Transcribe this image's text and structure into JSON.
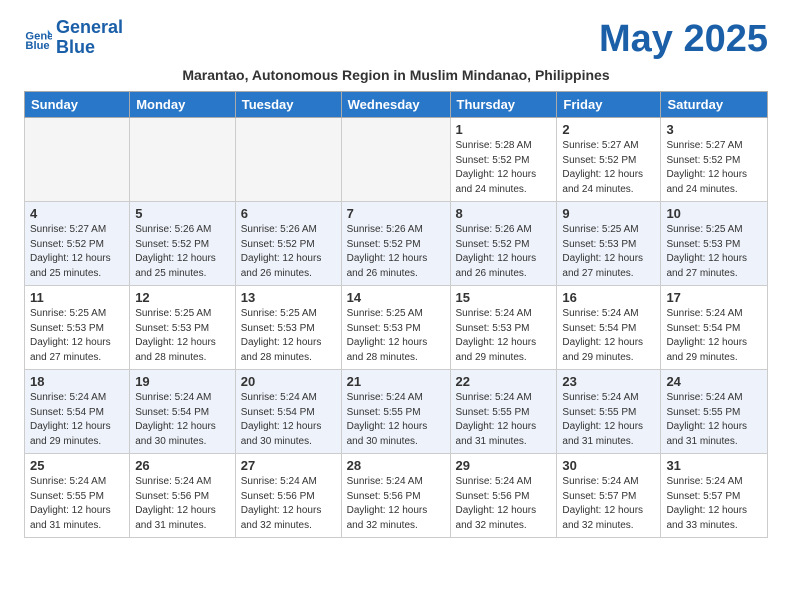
{
  "header": {
    "logo_line1": "General",
    "logo_line2": "Blue",
    "month_title": "May 2025",
    "subtitle": "Marantao, Autonomous Region in Muslim Mindanao, Philippines"
  },
  "days_of_week": [
    "Sunday",
    "Monday",
    "Tuesday",
    "Wednesday",
    "Thursday",
    "Friday",
    "Saturday"
  ],
  "weeks": [
    [
      {
        "day": "",
        "info": ""
      },
      {
        "day": "",
        "info": ""
      },
      {
        "day": "",
        "info": ""
      },
      {
        "day": "",
        "info": ""
      },
      {
        "day": "1",
        "info": "Sunrise: 5:28 AM\nSunset: 5:52 PM\nDaylight: 12 hours\nand 24 minutes."
      },
      {
        "day": "2",
        "info": "Sunrise: 5:27 AM\nSunset: 5:52 PM\nDaylight: 12 hours\nand 24 minutes."
      },
      {
        "day": "3",
        "info": "Sunrise: 5:27 AM\nSunset: 5:52 PM\nDaylight: 12 hours\nand 24 minutes."
      }
    ],
    [
      {
        "day": "4",
        "info": "Sunrise: 5:27 AM\nSunset: 5:52 PM\nDaylight: 12 hours\nand 25 minutes."
      },
      {
        "day": "5",
        "info": "Sunrise: 5:26 AM\nSunset: 5:52 PM\nDaylight: 12 hours\nand 25 minutes."
      },
      {
        "day": "6",
        "info": "Sunrise: 5:26 AM\nSunset: 5:52 PM\nDaylight: 12 hours\nand 26 minutes."
      },
      {
        "day": "7",
        "info": "Sunrise: 5:26 AM\nSunset: 5:52 PM\nDaylight: 12 hours\nand 26 minutes."
      },
      {
        "day": "8",
        "info": "Sunrise: 5:26 AM\nSunset: 5:52 PM\nDaylight: 12 hours\nand 26 minutes."
      },
      {
        "day": "9",
        "info": "Sunrise: 5:25 AM\nSunset: 5:53 PM\nDaylight: 12 hours\nand 27 minutes."
      },
      {
        "day": "10",
        "info": "Sunrise: 5:25 AM\nSunset: 5:53 PM\nDaylight: 12 hours\nand 27 minutes."
      }
    ],
    [
      {
        "day": "11",
        "info": "Sunrise: 5:25 AM\nSunset: 5:53 PM\nDaylight: 12 hours\nand 27 minutes."
      },
      {
        "day": "12",
        "info": "Sunrise: 5:25 AM\nSunset: 5:53 PM\nDaylight: 12 hours\nand 28 minutes."
      },
      {
        "day": "13",
        "info": "Sunrise: 5:25 AM\nSunset: 5:53 PM\nDaylight: 12 hours\nand 28 minutes."
      },
      {
        "day": "14",
        "info": "Sunrise: 5:25 AM\nSunset: 5:53 PM\nDaylight: 12 hours\nand 28 minutes."
      },
      {
        "day": "15",
        "info": "Sunrise: 5:24 AM\nSunset: 5:53 PM\nDaylight: 12 hours\nand 29 minutes."
      },
      {
        "day": "16",
        "info": "Sunrise: 5:24 AM\nSunset: 5:54 PM\nDaylight: 12 hours\nand 29 minutes."
      },
      {
        "day": "17",
        "info": "Sunrise: 5:24 AM\nSunset: 5:54 PM\nDaylight: 12 hours\nand 29 minutes."
      }
    ],
    [
      {
        "day": "18",
        "info": "Sunrise: 5:24 AM\nSunset: 5:54 PM\nDaylight: 12 hours\nand 29 minutes."
      },
      {
        "day": "19",
        "info": "Sunrise: 5:24 AM\nSunset: 5:54 PM\nDaylight: 12 hours\nand 30 minutes."
      },
      {
        "day": "20",
        "info": "Sunrise: 5:24 AM\nSunset: 5:54 PM\nDaylight: 12 hours\nand 30 minutes."
      },
      {
        "day": "21",
        "info": "Sunrise: 5:24 AM\nSunset: 5:55 PM\nDaylight: 12 hours\nand 30 minutes."
      },
      {
        "day": "22",
        "info": "Sunrise: 5:24 AM\nSunset: 5:55 PM\nDaylight: 12 hours\nand 31 minutes."
      },
      {
        "day": "23",
        "info": "Sunrise: 5:24 AM\nSunset: 5:55 PM\nDaylight: 12 hours\nand 31 minutes."
      },
      {
        "day": "24",
        "info": "Sunrise: 5:24 AM\nSunset: 5:55 PM\nDaylight: 12 hours\nand 31 minutes."
      }
    ],
    [
      {
        "day": "25",
        "info": "Sunrise: 5:24 AM\nSunset: 5:55 PM\nDaylight: 12 hours\nand 31 minutes."
      },
      {
        "day": "26",
        "info": "Sunrise: 5:24 AM\nSunset: 5:56 PM\nDaylight: 12 hours\nand 31 minutes."
      },
      {
        "day": "27",
        "info": "Sunrise: 5:24 AM\nSunset: 5:56 PM\nDaylight: 12 hours\nand 32 minutes."
      },
      {
        "day": "28",
        "info": "Sunrise: 5:24 AM\nSunset: 5:56 PM\nDaylight: 12 hours\nand 32 minutes."
      },
      {
        "day": "29",
        "info": "Sunrise: 5:24 AM\nSunset: 5:56 PM\nDaylight: 12 hours\nand 32 minutes."
      },
      {
        "day": "30",
        "info": "Sunrise: 5:24 AM\nSunset: 5:57 PM\nDaylight: 12 hours\nand 32 minutes."
      },
      {
        "day": "31",
        "info": "Sunrise: 5:24 AM\nSunset: 5:57 PM\nDaylight: 12 hours\nand 33 minutes."
      }
    ]
  ]
}
